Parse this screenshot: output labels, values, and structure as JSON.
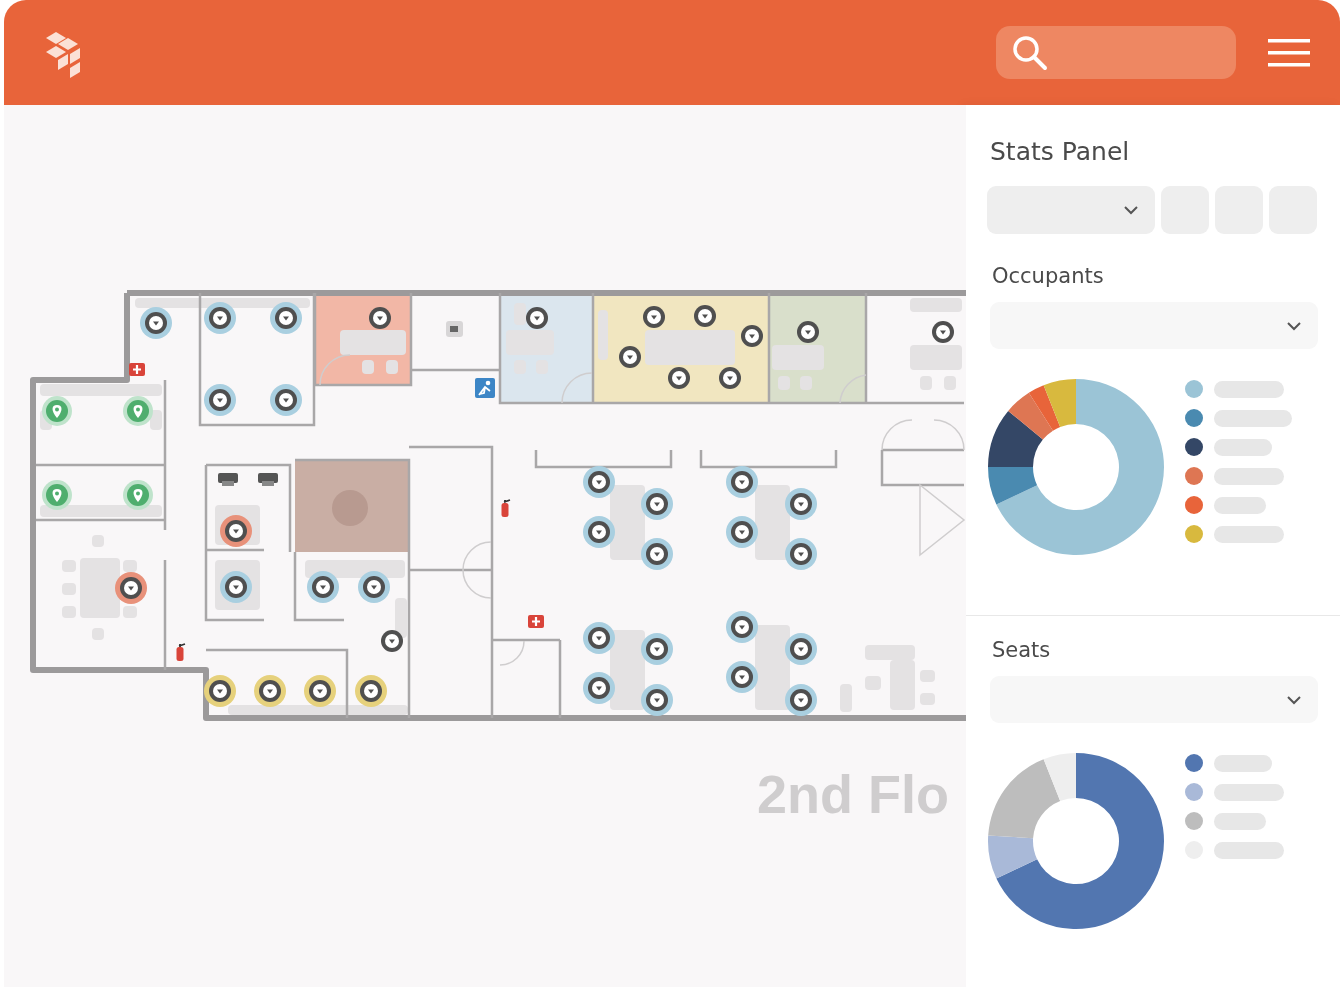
{
  "map": {
    "floor_label": "2nd Flo",
    "markers": [
      {
        "kind": "seat",
        "color": "#a9cfe0"
      },
      {
        "kind": "seat",
        "color": "#a9cfe0"
      },
      {
        "kind": "seat",
        "color": "#a9cfe0"
      },
      {
        "kind": "seat",
        "color": "#a9cfe0"
      },
      {
        "kind": "seat",
        "color": "#a9cfe0"
      },
      {
        "kind": "seat",
        "color": "#a9cfe0"
      },
      {
        "kind": "seat",
        "color": "#a9cfe0"
      },
      {
        "kind": "seat",
        "color": "#a9cfe0"
      },
      {
        "kind": "seat",
        "color": "#a9cfe0"
      },
      {
        "kind": "seat",
        "color": "#a9cfe0"
      },
      {
        "kind": "seat",
        "color": "#a9cfe0"
      },
      {
        "kind": "seat",
        "color": "#a9cfe0"
      },
      {
        "kind": "seat",
        "color": "#a9cfe0"
      },
      {
        "kind": "seat",
        "color": "#a9cfe0"
      },
      {
        "kind": "seat",
        "color": "#a9cfe0"
      },
      {
        "kind": "seat",
        "color": "#a9cfe0"
      },
      {
        "kind": "seat",
        "color": "#a9cfe0"
      },
      {
        "kind": "seat",
        "color": "#a9cfe0"
      },
      {
        "kind": "seat",
        "color": "#a9cfe0"
      },
      {
        "kind": "seat",
        "color": "#a9cfe0"
      },
      {
        "kind": "seat",
        "color": "#a9cfe0"
      },
      {
        "kind": "seat",
        "color": "#a9cfe0"
      },
      {
        "kind": "seat",
        "color": "#a9cfe0"
      },
      {
        "kind": "seat",
        "color": "#a9cfe0"
      },
      {
        "kind": "plain"
      },
      {
        "kind": "plain"
      },
      {
        "kind": "plain"
      },
      {
        "kind": "plain"
      },
      {
        "kind": "plain"
      },
      {
        "kind": "plain"
      },
      {
        "kind": "plain"
      },
      {
        "kind": "plain"
      },
      {
        "kind": "plain"
      },
      {
        "kind": "plain"
      },
      {
        "kind": "plain"
      },
      {
        "kind": "seat",
        "color": "#e8917a"
      },
      {
        "kind": "seat",
        "color": "#e8917a"
      },
      {
        "kind": "seat",
        "color": "#e6d17c"
      },
      {
        "kind": "seat",
        "color": "#e6d17c"
      },
      {
        "kind": "seat",
        "color": "#e6d17c"
      },
      {
        "kind": "seat",
        "color": "#e6d17c"
      },
      {
        "kind": "pin"
      },
      {
        "kind": "pin"
      },
      {
        "kind": "pin"
      },
      {
        "kind": "pin"
      }
    ]
  },
  "stats_panel": {
    "title": "Stats Panel",
    "sections": [
      {
        "title": "Occupants",
        "legend": [
          {
            "color": "#9bc4d6"
          },
          {
            "color": "#4a8ab0"
          },
          {
            "color": "#344766"
          },
          {
            "color": "#de7653"
          },
          {
            "color": "#e8643a"
          },
          {
            "color": "#d8b93e"
          }
        ]
      },
      {
        "title": "Seats",
        "legend": [
          {
            "color": "#5276b0"
          },
          {
            "color": "#a9b9d8"
          },
          {
            "color": "#bdbdbd"
          },
          {
            "color": "#eeeeee"
          }
        ]
      }
    ]
  }
}
